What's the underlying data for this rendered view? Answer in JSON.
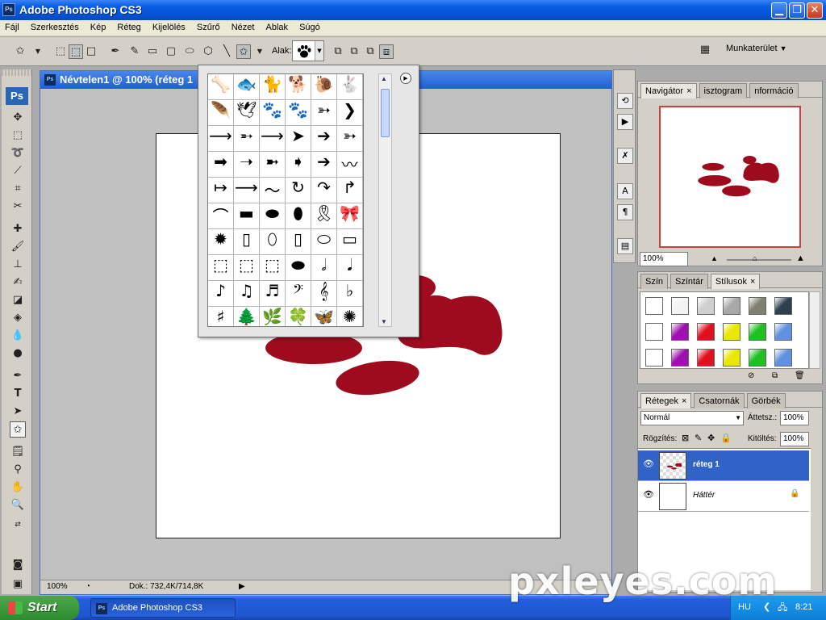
{
  "window": {
    "title": "Adobe Photoshop CS3",
    "icon": "Ps",
    "buttons": [
      "minimize-icon",
      "restore-icon",
      "close-icon"
    ]
  },
  "menu": [
    "Fájl",
    "Szerkesztés",
    "Kép",
    "Réteg",
    "Kijelölés",
    "Szűrő",
    "Nézet",
    "Ablak",
    "Súgó"
  ],
  "options": {
    "shape_label": "Alak:",
    "workspace_label": "Munkaterület"
  },
  "toolbox": {
    "logo": "Ps",
    "foreground_color": "#8b0e22",
    "background_color": "#000000"
  },
  "document": {
    "title": "Névtelen1 @ 100% (réteg 1",
    "icon": "Ps",
    "zoom": "100%",
    "doc_info": "Dok.: 732,4K/714,8K",
    "shape_color": "#9e0b1f"
  },
  "shape_popup": {
    "shapes": [
      "🦴",
      "🐟",
      "🐈",
      "🐕",
      "🐌",
      "🐇",
      "🪶",
      "🕊",
      "🐾",
      "🐾",
      "➳",
      "❯",
      "⟶",
      "➵",
      "⟶",
      "➤",
      "➔",
      "➳",
      "➡",
      "➝",
      "➼",
      "➧",
      "➔",
      "〰",
      "↦",
      "⟶",
      "〜",
      "↻",
      "↷",
      "↱",
      "⌒",
      "▬",
      "⬬",
      "⬮",
      "🎗",
      "🎀",
      "✹",
      "▯",
      "⬯",
      "▯",
      "⬭",
      "▭",
      "⬚",
      "⬚",
      "⬚",
      "⬬",
      "𝅗𝅥",
      "𝅘𝅥",
      "♪",
      "♫",
      "♬",
      "𝄢",
      "𝄞",
      "♭",
      "♯",
      "🌲",
      "🌿",
      "🍀",
      "🦋",
      "✺"
    ]
  },
  "navigator": {
    "tabs": [
      "Navigátor",
      "isztogram",
      "nformáció"
    ],
    "zoom": "100%",
    "frame_color": "#d33c3c"
  },
  "styles_panel": {
    "tabs": [
      "Szín",
      "Színtár",
      "Stílusok"
    ],
    "swatches": [
      "#ffffff",
      "#f4f4f4",
      "#cfcfcf",
      "#a8a8a8",
      "#808070",
      "#2e3f4f",
      "#ffffff",
      "#a010b0",
      "#e01020",
      "#e8e800",
      "#20c020",
      "#6090e0",
      "#ffffff",
      "#a010b0",
      "#e01020",
      "#e8e800",
      "#20c020",
      "#6090e0"
    ]
  },
  "layers_panel": {
    "tabs": [
      "Rétegek",
      "Csatornák",
      "Görbék"
    ],
    "blend_mode": "Normál",
    "opacity_label": "Áttetsz.:",
    "opacity": "100%",
    "lock_label": "Rögzítés:",
    "fill_label": "Kitöltés:",
    "fill": "100%",
    "layers": [
      {
        "name": "réteg 1",
        "selected": true
      },
      {
        "name": "Háttér",
        "selected": false
      }
    ]
  },
  "taskbar": {
    "start": "Start",
    "item": "Adobe Photoshop CS3",
    "lang": "HU",
    "time": "8:21"
  },
  "watermark": "pxleyes.com"
}
